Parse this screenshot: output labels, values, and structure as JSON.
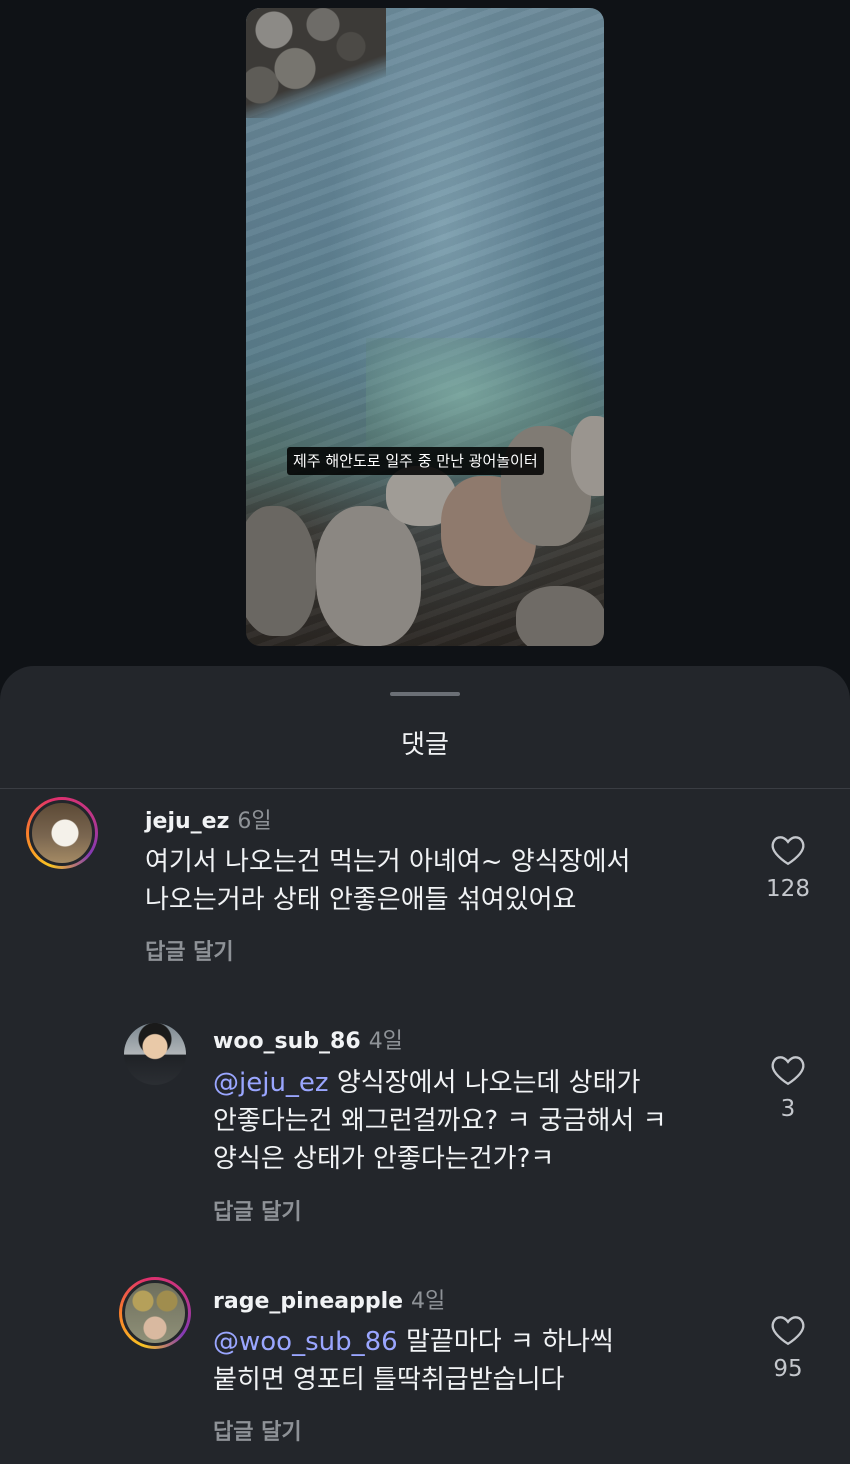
{
  "video": {
    "caption": "제주 해안도로 일주 중 만난 광어놀이터"
  },
  "sheet": {
    "title": "댓글"
  },
  "comments": [
    {
      "username": "jeju_ez",
      "time": "6일",
      "text_line1": "여기서 나오는건 먹는거 아녜여~ 양식장에서",
      "text_line2": "나오는거라 상태 안좋은애들 섞여있어요",
      "reply_label": "답글 달기",
      "likes": "128"
    },
    {
      "username": "woo_sub_86",
      "time": "4일",
      "mention": "@jeju_ez",
      "text_line1": " 양식장에서 나오는데 상태가",
      "text_line2": "안좋다는건 왜그런걸까요? ㅋ 궁금해서 ㅋ",
      "text_line3": "양식은 상태가 안좋다는건가?ㅋ",
      "reply_label": "답글 달기",
      "likes": "3"
    },
    {
      "username": "rage_pineapple",
      "time": "4일",
      "mention": "@woo_sub_86",
      "text_line1": " 말끝마다 ㅋ 하나씩",
      "text_line2": "붙히면 영포티 틀딱취급받습니다",
      "reply_label": "답글 달기",
      "likes": "95"
    }
  ],
  "colors": {
    "background": "#0f1216",
    "sheet": "#23262b",
    "mention": "#9aa6ff",
    "muted": "#8e9297"
  },
  "icons": {
    "like": "heart-outline-icon"
  }
}
